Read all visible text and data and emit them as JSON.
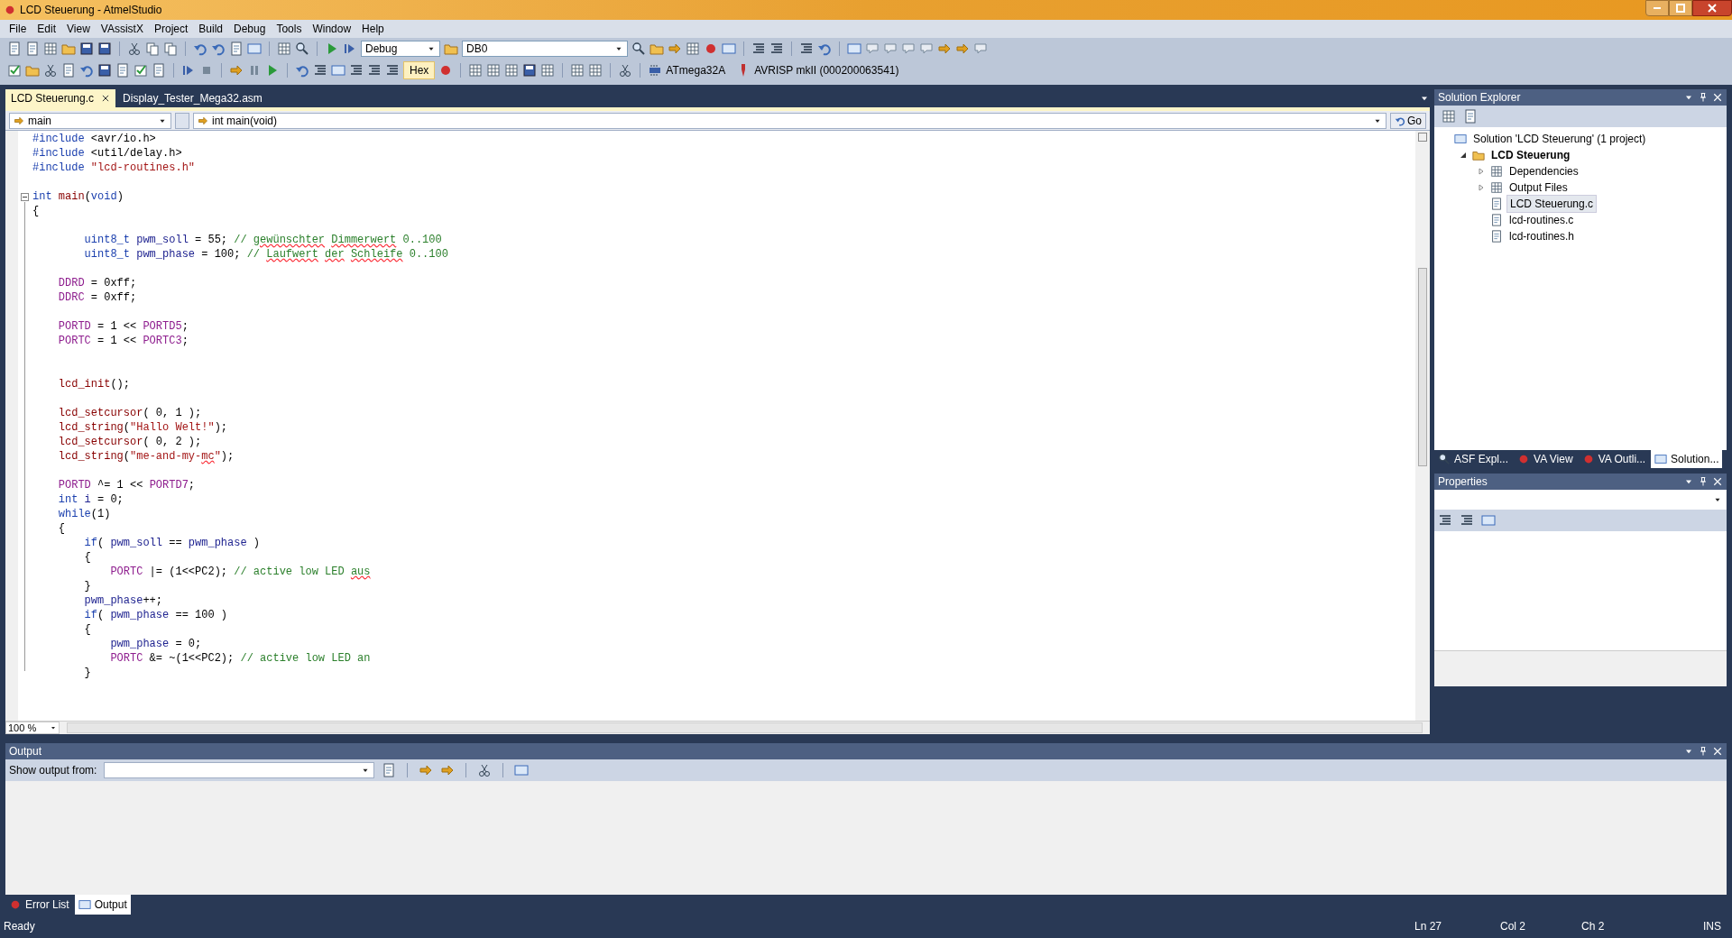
{
  "window": {
    "title": "LCD Steuerung - AtmelStudio"
  },
  "menu": [
    "File",
    "Edit",
    "View",
    "VAssistX",
    "Project",
    "Build",
    "Debug",
    "Tools",
    "Window",
    "Help"
  ],
  "toolbar": {
    "configuration": "Debug",
    "platform": "DB0",
    "hex_button": "Hex",
    "device": "ATmega32A",
    "tool": "AVRISP mkII (000200063541)"
  },
  "document_tabs": [
    {
      "label": "LCD Steuerung.c",
      "selected": true
    },
    {
      "label": "Display_Tester_Mega32.asm",
      "selected": false
    }
  ],
  "navigation": {
    "scope": "main",
    "member": "int main(void)",
    "go_button": "Go"
  },
  "code_lines": [
    {
      "kind": "code",
      "tokens": [
        {
          "kind": "keyword",
          "text": "#include"
        },
        {
          "kind": "plain",
          "text": " <avr/io.h>"
        }
      ]
    },
    {
      "kind": "code",
      "tokens": [
        {
          "kind": "keyword",
          "text": "#include"
        },
        {
          "kind": "plain",
          "text": " <util/delay.h>"
        }
      ]
    },
    {
      "kind": "code",
      "tokens": [
        {
          "kind": "keyword",
          "text": "#include "
        },
        {
          "kind": "string",
          "text": "\"lcd-routines.h\""
        }
      ]
    },
    {
      "kind": "blank"
    },
    {
      "kind": "fold-start",
      "tokens": [
        {
          "kind": "keyword",
          "text": "int "
        },
        {
          "kind": "function",
          "text": "main"
        },
        {
          "kind": "plain",
          "text": "("
        },
        {
          "kind": "keyword",
          "text": "void"
        },
        {
          "kind": "plain",
          "text": ")"
        }
      ]
    },
    {
      "kind": "code",
      "tokens": [
        {
          "kind": "plain",
          "text": "{"
        }
      ]
    },
    {
      "kind": "blank"
    },
    {
      "kind": "code",
      "tokens": [
        {
          "kind": "keyword",
          "text": "        uint8_t "
        },
        {
          "kind": "identifier",
          "text": "pwm_soll"
        },
        {
          "kind": "plain",
          "text": " = 55; "
        },
        {
          "kind": "comment",
          "text": "// "
        },
        {
          "kind": "comment-misspelled",
          "text": "gewünschter "
        },
        {
          "kind": "comment-misspelled",
          "text": "Dimmerwert"
        },
        {
          "kind": "comment",
          "text": " 0..100"
        }
      ]
    },
    {
      "kind": "code",
      "tokens": [
        {
          "kind": "keyword",
          "text": "        uint8_t "
        },
        {
          "kind": "identifier",
          "text": "pwm_phase"
        },
        {
          "kind": "plain",
          "text": " = 100; "
        },
        {
          "kind": "comment",
          "text": "// "
        },
        {
          "kind": "comment-misspelled",
          "text": "Laufwert "
        },
        {
          "kind": "comment-misspelled",
          "text": "der "
        },
        {
          "kind": "comment-misspelled",
          "text": "Schleife"
        },
        {
          "kind": "comment",
          "text": " 0..100"
        }
      ]
    },
    {
      "kind": "blank"
    },
    {
      "kind": "code",
      "tokens": [
        {
          "kind": "macro",
          "text": "    DDRD"
        },
        {
          "kind": "plain",
          "text": " = 0xff;"
        }
      ]
    },
    {
      "kind": "code",
      "tokens": [
        {
          "kind": "macro",
          "text": "    DDRC"
        },
        {
          "kind": "plain",
          "text": " = 0xff;"
        }
      ]
    },
    {
      "kind": "blank"
    },
    {
      "kind": "code",
      "tokens": [
        {
          "kind": "macro",
          "text": "    PORTD"
        },
        {
          "kind": "plain",
          "text": " = 1 << "
        },
        {
          "kind": "macro",
          "text": "PORTD5"
        },
        {
          "kind": "plain",
          "text": ";"
        }
      ]
    },
    {
      "kind": "code",
      "tokens": [
        {
          "kind": "macro",
          "text": "    PORTC"
        },
        {
          "kind": "plain",
          "text": " = 1 << "
        },
        {
          "kind": "macro",
          "text": "PORTC3"
        },
        {
          "kind": "plain",
          "text": ";"
        }
      ]
    },
    {
      "kind": "blank"
    },
    {
      "kind": "blank"
    },
    {
      "kind": "code",
      "tokens": [
        {
          "kind": "function",
          "text": "    lcd_init"
        },
        {
          "kind": "plain",
          "text": "();"
        }
      ]
    },
    {
      "kind": "blank"
    },
    {
      "kind": "code",
      "tokens": [
        {
          "kind": "function",
          "text": "    lcd_setcursor"
        },
        {
          "kind": "plain",
          "text": "( 0, 1 );"
        }
      ]
    },
    {
      "kind": "code",
      "tokens": [
        {
          "kind": "function",
          "text": "    lcd_string"
        },
        {
          "kind": "plain",
          "text": "("
        },
        {
          "kind": "string",
          "text": "\"Hallo Welt!\""
        },
        {
          "kind": "plain",
          "text": ");"
        }
      ]
    },
    {
      "kind": "code",
      "tokens": [
        {
          "kind": "function",
          "text": "    lcd_setcursor"
        },
        {
          "kind": "plain",
          "text": "( 0, 2 );"
        }
      ]
    },
    {
      "kind": "code",
      "tokens": [
        {
          "kind": "function",
          "text": "    lcd_string"
        },
        {
          "kind": "plain",
          "text": "("
        },
        {
          "kind": "string",
          "text": "\"me-and-my-"
        },
        {
          "kind": "string-misspelled",
          "text": "mc"
        },
        {
          "kind": "string",
          "text": "\""
        },
        {
          "kind": "plain",
          "text": ");"
        }
      ]
    },
    {
      "kind": "blank"
    },
    {
      "kind": "code",
      "tokens": [
        {
          "kind": "macro",
          "text": "    PORTD"
        },
        {
          "kind": "plain",
          "text": " ^= 1 << "
        },
        {
          "kind": "macro",
          "text": "PORTD7"
        },
        {
          "kind": "plain",
          "text": ";"
        }
      ]
    },
    {
      "kind": "code",
      "tokens": [
        {
          "kind": "keyword",
          "text": "    int "
        },
        {
          "kind": "identifier",
          "text": "i"
        },
        {
          "kind": "plain",
          "text": " = 0;"
        }
      ]
    },
    {
      "kind": "code",
      "tokens": [
        {
          "kind": "keyword",
          "text": "    while"
        },
        {
          "kind": "plain",
          "text": "(1)"
        }
      ]
    },
    {
      "kind": "code",
      "tokens": [
        {
          "kind": "plain",
          "text": "    {"
        }
      ]
    },
    {
      "kind": "code",
      "tokens": [
        {
          "kind": "keyword",
          "text": "        if"
        },
        {
          "kind": "plain",
          "text": "( "
        },
        {
          "kind": "identifier",
          "text": "pwm_soll"
        },
        {
          "kind": "plain",
          "text": " == "
        },
        {
          "kind": "identifier",
          "text": "pwm_phase"
        },
        {
          "kind": "plain",
          "text": " )"
        }
      ]
    },
    {
      "kind": "code",
      "tokens": [
        {
          "kind": "plain",
          "text": "        {"
        }
      ]
    },
    {
      "kind": "code",
      "tokens": [
        {
          "kind": "macro",
          "text": "            PORTC"
        },
        {
          "kind": "plain",
          "text": " |= (1<<PC2); "
        },
        {
          "kind": "comment",
          "text": "// active low LED "
        },
        {
          "kind": "comment-misspelled",
          "text": "aus"
        }
      ]
    },
    {
      "kind": "code",
      "tokens": [
        {
          "kind": "plain",
          "text": "        }"
        }
      ]
    },
    {
      "kind": "code",
      "tokens": [
        {
          "kind": "identifier",
          "text": "        pwm_phase"
        },
        {
          "kind": "plain",
          "text": "++;"
        }
      ]
    },
    {
      "kind": "code",
      "tokens": [
        {
          "kind": "keyword",
          "text": "        if"
        },
        {
          "kind": "plain",
          "text": "( "
        },
        {
          "kind": "identifier",
          "text": "pwm_phase"
        },
        {
          "kind": "plain",
          "text": " == 100 )"
        }
      ]
    },
    {
      "kind": "code",
      "tokens": [
        {
          "kind": "plain",
          "text": "        {"
        }
      ]
    },
    {
      "kind": "code",
      "tokens": [
        {
          "kind": "identifier",
          "text": "            pwm_phase"
        },
        {
          "kind": "plain",
          "text": " = 0;"
        }
      ]
    },
    {
      "kind": "code",
      "tokens": [
        {
          "kind": "macro",
          "text": "            PORTC"
        },
        {
          "kind": "plain",
          "text": " &= ~(1<<PC2); "
        },
        {
          "kind": "comment",
          "text": "// active low LED an"
        }
      ]
    },
    {
      "kind": "code",
      "tokens": [
        {
          "kind": "plain",
          "text": "        }"
        }
      ]
    }
  ],
  "zoom": "100 %",
  "solution_explorer": {
    "title": "Solution Explorer",
    "tree": [
      {
        "label": "Solution 'LCD Steuerung' (1 project)",
        "kind": "solution",
        "selected": false,
        "children": [
          {
            "label": "LCD Steuerung",
            "kind": "project",
            "expanded": true,
            "selected": false,
            "children": [
              {
                "label": "Dependencies",
                "kind": "folder",
                "expanded": false,
                "selected": false
              },
              {
                "label": "Output Files",
                "kind": "folder",
                "expanded": false,
                "selected": false
              },
              {
                "label": "LCD Steuerung.c",
                "kind": "c-file",
                "selected": true
              },
              {
                "label": "lcd-routines.c",
                "kind": "c-file",
                "selected": false
              },
              {
                "label": "lcd-routines.h",
                "kind": "h-file",
                "selected": false
              }
            ]
          }
        ]
      }
    ]
  },
  "panel_tabs": [
    {
      "label": "ASF Expl...",
      "selected": false
    },
    {
      "label": "VA View",
      "selected": false
    },
    {
      "label": "VA Outli...",
      "selected": false
    },
    {
      "label": "Solution...",
      "selected": true
    }
  ],
  "properties": {
    "title": "Properties"
  },
  "output": {
    "title": "Output",
    "show_from_label": "Show output from:"
  },
  "bottom_tabs": [
    {
      "label": "Error List",
      "selected": false
    },
    {
      "label": "Output",
      "selected": true
    }
  ],
  "status_bar": {
    "message": "Ready",
    "line": "Ln 27",
    "column": "Col 2",
    "char": "Ch 2",
    "mode": "INS"
  }
}
